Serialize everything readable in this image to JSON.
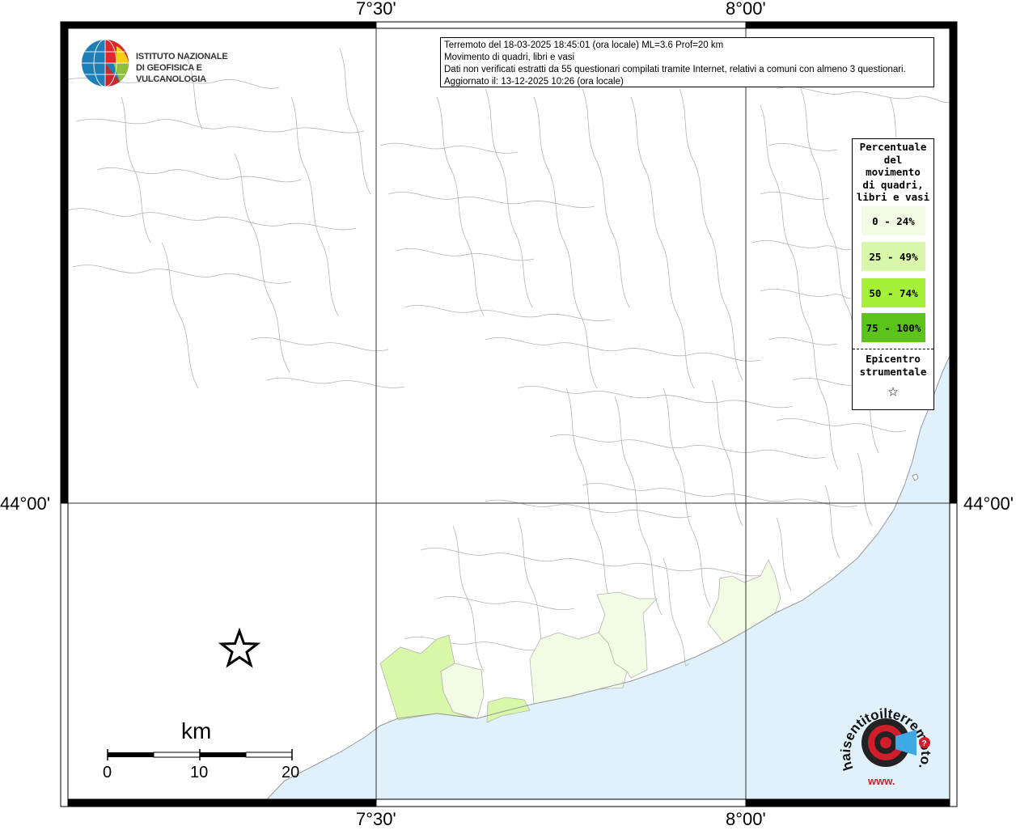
{
  "title": {
    "line1": "Terremoto del 18-03-2025 18:45:01 (ora locale) ML=3.6 Prof=20 km",
    "line2": "Movimento di quadri, libri e vasi",
    "line3": "Dati non verificati estratti da 55 questionari compilati tramite Internet, relativi a comuni con almeno 3 questionari.",
    "line4": "Aggiornato il: 13-12-2025 10:26 (ora locale)"
  },
  "ingv_logo": {
    "line1": "ISTITUTO NAZIONALE",
    "line2": "DI GEOFISICA E VULCANOLOGIA"
  },
  "axes": {
    "top": [
      "7°30'",
      "8°00'"
    ],
    "bottom": [
      "7°30'",
      "8°00'"
    ],
    "left": [
      "44°00'"
    ],
    "right": [
      "44°00'"
    ]
  },
  "legend": {
    "title": [
      "Percentuale",
      "del",
      "movimento",
      "di quadri,",
      "libri e vasi"
    ],
    "classes": [
      {
        "label": "0 - 24%",
        "color": "#f2fbe4"
      },
      {
        "label": "25 - 49%",
        "color": "#d8f7a8"
      },
      {
        "label": "50 - 74%",
        "color": "#a6f03a"
      },
      {
        "label": "75 - 100%",
        "color": "#5cc418"
      }
    ],
    "epicenter_title": [
      "Epicentro",
      "strumentale"
    ],
    "epicenter_symbol": "☆"
  },
  "scale_bar": {
    "unit": "km",
    "ticks": [
      "0",
      "10",
      "20"
    ]
  },
  "hst_logo": {
    "text": "haisentitoilterremoto.it",
    "prefix": "www."
  },
  "colors": {
    "sea": "#e0f1fb",
    "boundary": "#b4b4b4",
    "frame": "#000000"
  }
}
